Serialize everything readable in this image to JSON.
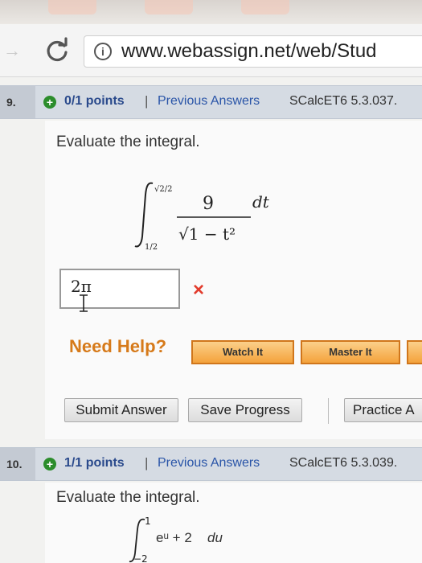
{
  "browser": {
    "url": "www.webassign.net/web/Stud",
    "info_symbol": "i"
  },
  "question9": {
    "number": "9.",
    "points": "0/1 points",
    "separator": "|",
    "previous_answers": "Previous Answers",
    "reference": "SCalcET6 5.3.037.",
    "prompt": "Evaluate the integral.",
    "integral": {
      "lower": "1/2",
      "upper": "√2/2",
      "numerator": "9",
      "denominator": "√1 − t²",
      "differential": "dt"
    },
    "answer_value": "2π",
    "status_mark": "×",
    "need_help": "Need Help?",
    "watch_it": "Watch It",
    "master_it": "Master It",
    "submit_answer": "Submit Answer",
    "save_progress": "Save Progress",
    "practice": "Practice A"
  },
  "question10": {
    "number": "10.",
    "points": "1/1 points",
    "separator": "|",
    "previous_answers": "Previous Answers",
    "reference": "SCalcET6 5.3.039.",
    "prompt": "Evaluate the integral.",
    "integral": {
      "lower": "−2",
      "upper": "1",
      "integrand": "eᵘ + 2",
      "differential": "du"
    }
  },
  "colors": {
    "points_blue": "#2a4a8c",
    "help_orange": "#d67a1a",
    "wrong_red": "#e23b2c",
    "correct_green": "#2c8d2c"
  }
}
